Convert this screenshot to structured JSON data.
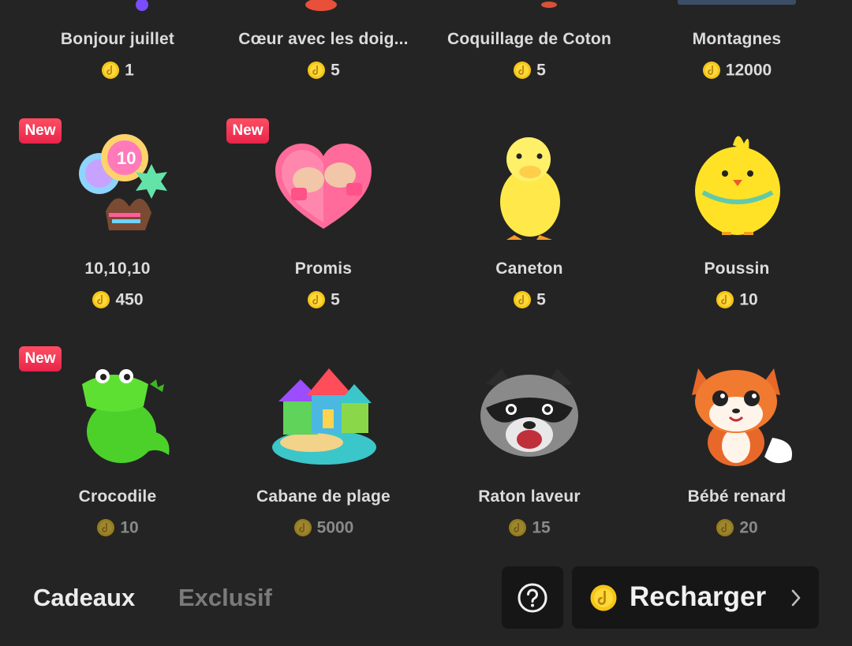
{
  "gifts": [
    {
      "name": "Bonjour juillet",
      "price": "1",
      "icon": "hello-july-gift-icon",
      "badge": null,
      "dim": false
    },
    {
      "name": "Cœur avec les doig...",
      "price": "5",
      "icon": "finger-heart-gift-icon",
      "badge": null,
      "dim": false
    },
    {
      "name": "Coquillage de Coton",
      "price": "5",
      "icon": "cotton-shell-gift-icon",
      "badge": null,
      "dim": false
    },
    {
      "name": "Montagnes",
      "price": "12000",
      "icon": "mountains-gift-icon",
      "badge": null,
      "dim": false
    },
    {
      "name": "10,10,10",
      "price": "450",
      "icon": "ten-ten-ten-balloons-gift-icon",
      "badge": "New",
      "dim": false
    },
    {
      "name": "Promis",
      "price": "5",
      "icon": "pinky-promise-heart-gift-icon",
      "badge": "New",
      "dim": false
    },
    {
      "name": "Caneton",
      "price": "5",
      "icon": "duckling-gift-icon",
      "badge": null,
      "dim": false
    },
    {
      "name": "Poussin",
      "price": "10",
      "icon": "chick-gift-icon",
      "badge": null,
      "dim": false
    },
    {
      "name": "Crocodile",
      "price": "10",
      "icon": "crocodile-gift-icon",
      "badge": "New",
      "dim": true
    },
    {
      "name": "Cabane de plage",
      "price": "5000",
      "icon": "beach-hut-gift-icon",
      "badge": null,
      "dim": true
    },
    {
      "name": "Raton laveur",
      "price": "15",
      "icon": "raccoon-gift-icon",
      "badge": null,
      "dim": true
    },
    {
      "name": "Bébé renard",
      "price": "20",
      "icon": "baby-fox-gift-icon",
      "badge": null,
      "dim": true
    }
  ],
  "tabs": {
    "gifts": "Cadeaux",
    "exclusive": "Exclusif"
  },
  "recharge": {
    "label": "Recharger",
    "icons": [
      "coin-icon",
      "chevron-right-icon"
    ]
  },
  "help": {
    "icon": "question-mark-icon"
  },
  "colors": {
    "background": "#242424",
    "button": "#161616",
    "coin": "#f5c518",
    "badge": "#ff3b5c"
  }
}
